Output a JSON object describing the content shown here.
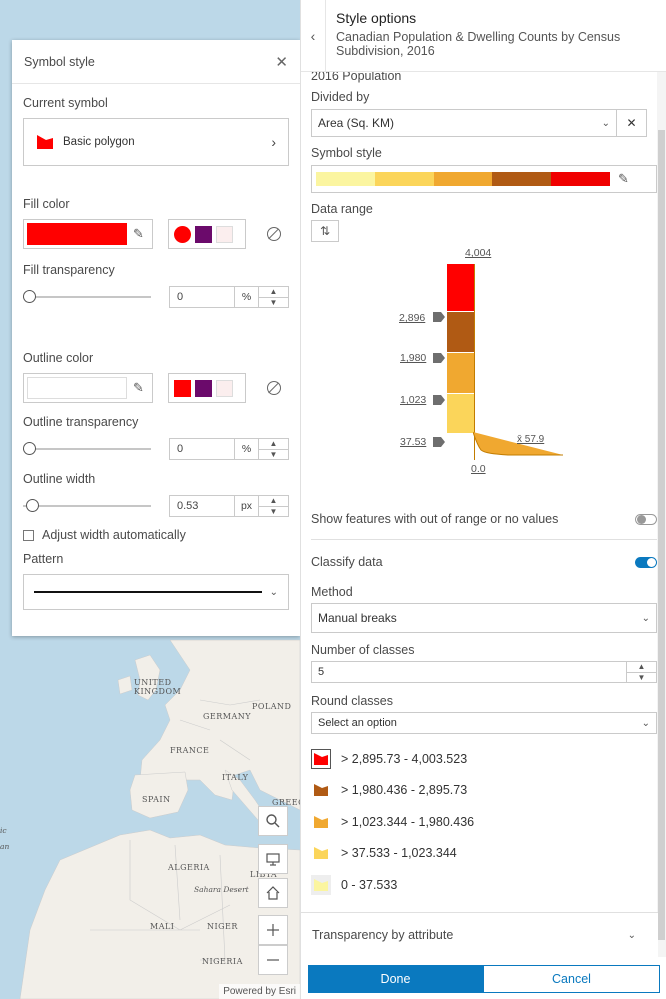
{
  "map": {
    "labels": {
      "united_kingdom": "UNITED\nKINGDOM",
      "poland": "POLAND",
      "germany": "GERMANY",
      "france": "FRANCE",
      "italy": "ITALY",
      "spain": "SPAIN",
      "greece": "GREECE",
      "algeria": "ALGERIA",
      "libya": "LIBYA",
      "sahara": "Sahara Desert",
      "mali": "MALI",
      "niger": "NIGER",
      "nigeria": "NIGERIA",
      "partial_ic": "ic",
      "partial_an": "an"
    },
    "attribution": "Powered by Esri",
    "colors": {
      "water": "#bcd8e8",
      "land": "#f2efe9"
    }
  },
  "symbol_style": {
    "title": "Symbol style",
    "current_symbol_label": "Current symbol",
    "current_symbol_name": "Basic polygon",
    "fill_color_label": "Fill color",
    "fill_color": "#ff0000",
    "fill_presets": [
      "#ff0000",
      "#6b0a6b",
      "#fbeeee"
    ],
    "fill_transparency_label": "Fill transparency",
    "fill_transparency_value": "0",
    "fill_transparency_unit": "%",
    "fill_transparency_fraction": 0,
    "outline_color_label": "Outline color",
    "outline_color": "#ffffff",
    "outline_presets": [
      "#ff0000",
      "#6b0a6b",
      "#fbeeee"
    ],
    "outline_transparency_label": "Outline transparency",
    "outline_transparency_value": "0",
    "outline_transparency_unit": "%",
    "outline_transparency_fraction": 0,
    "outline_width_label": "Outline width",
    "outline_width_value": "0.53",
    "outline_width_unit": "px",
    "outline_width_fraction": 0.03,
    "adjust_width_label": "Adjust width automatically",
    "adjust_width_checked": false,
    "pattern_label": "Pattern"
  },
  "style_options": {
    "title": "Style options",
    "subtitle": "Canadian Population & Dwelling Counts by Census Subdivision, 2016",
    "field_name": "2016 Population",
    "divided_by_label": "Divided by",
    "divided_by_value": "Area (Sq. KM)",
    "symbol_style_label": "Symbol style",
    "ramp_colors": [
      "#fbf5a0",
      "#fbd55a",
      "#f0a830",
      "#b05a14",
      "#f00000"
    ],
    "data_range_label": "Data range",
    "histogram": {
      "max_label": "4,004",
      "min_label": "0.0",
      "avg_label": "x̄ 57.9",
      "breaks": [
        "2,896",
        "1,980",
        "1,023",
        "37.53"
      ],
      "bar_colors": [
        "#ff0000",
        "#b05a14",
        "#f0a830",
        "#fbd55a"
      ]
    },
    "show_out_of_range_label": "Show features with out of range or no values",
    "show_out_of_range_on": false,
    "classify_label": "Classify data",
    "classify_on": true,
    "method_label": "Method",
    "method_value": "Manual breaks",
    "num_classes_label": "Number of classes",
    "num_classes_value": "5",
    "round_classes_label": "Round classes",
    "round_classes_placeholder": "Select an option",
    "classes": [
      {
        "label": "> 2,895.73 - 4,003.523",
        "color": "#ff0000",
        "selected": true
      },
      {
        "label": "> 1,980.436 - 2,895.73",
        "color": "#b05a14",
        "selected": false
      },
      {
        "label": "> 1,023.344 - 1,980.436",
        "color": "#f0a830",
        "selected": false
      },
      {
        "label": "> 37.533 - 1,023.344",
        "color": "#fbd55a",
        "selected": false
      },
      {
        "label": "0 - 37.533",
        "color": "#fbf5a0",
        "selected": false
      }
    ],
    "transparency_by_attribute_label": "Transparency by attribute",
    "done_label": "Done",
    "cancel_label": "Cancel",
    "accent": "#0a79bf"
  }
}
